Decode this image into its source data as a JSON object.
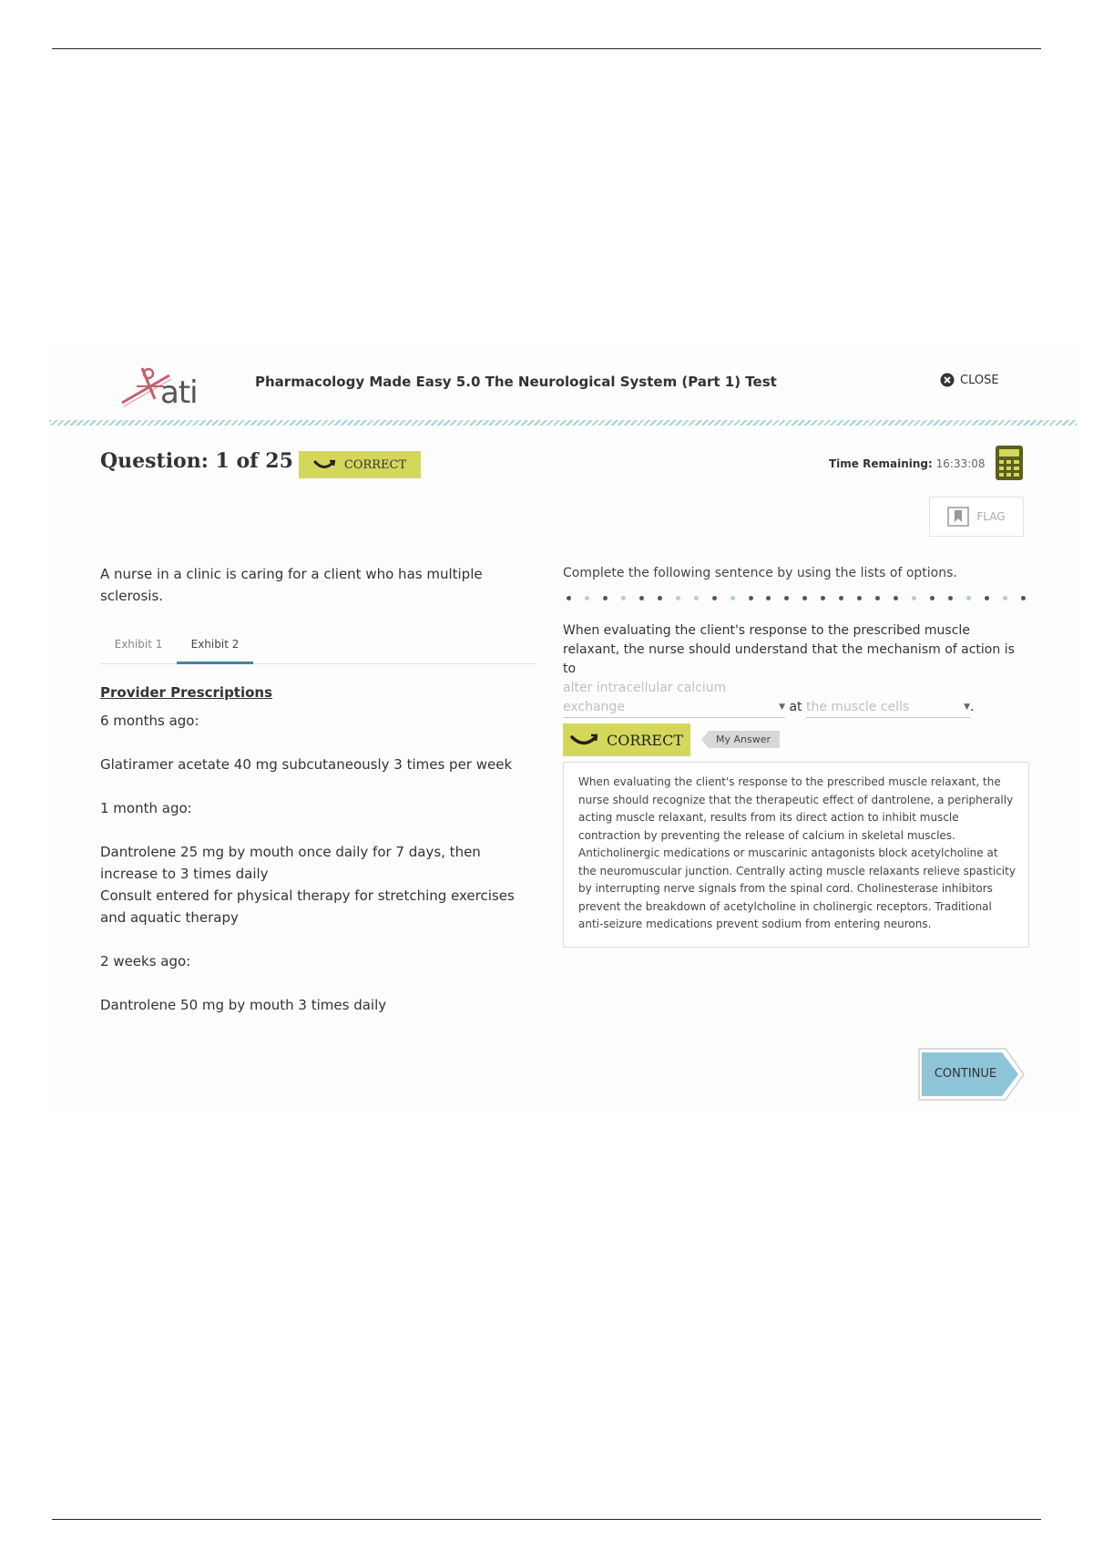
{
  "header": {
    "logo_text": "ati",
    "test_title": "Pharmacology Made Easy 5.0 The Neurological System (Part 1) Test",
    "close_label": "CLOSE"
  },
  "question_bar": {
    "question_label": "Question: 1 of 25",
    "status_label": "CORRECT",
    "time_label": "Time Remaining:",
    "time_value": "16:33:08",
    "flag_label": "FLAG"
  },
  "left_pane": {
    "stem": "A nurse in a clinic is caring for a client who has multiple sclerosis.",
    "tabs": [
      {
        "label": "Exhibit 1",
        "active": false
      },
      {
        "label": "Exhibit 2",
        "active": true
      }
    ],
    "exhibit_heading": "Provider Prescriptions",
    "prescriptions": {
      "t1": "6 months ago:",
      "t1_rx1": "Glatiramer acetate 40 mg subcutaneously 3 times per week",
      "t2": "1 month ago:",
      "t2_rx1": "Dantrolene 25 mg by mouth once daily for 7 days, then increase to 3 times daily",
      "t2_rx2": "Consult entered for physical therapy for stretching exercises and aquatic therapy",
      "t3": "2 weeks ago:",
      "t3_rx1": "Dantrolene 50 mg by mouth 3 times daily"
    }
  },
  "right_pane": {
    "instruction": "Complete the following sentence by using the lists of options.",
    "sentence_part1": "When evaluating the client's response to the prescribed muscle relaxant, the nurse should understand that the mechanism of action is to",
    "dropdown_1": "alter intracellular calcium exchange",
    "sentence_part2": "at",
    "dropdown_2": "the muscle cells",
    "sentence_end": ".",
    "result_label": "CORRECT",
    "my_answer_label": "My Answer",
    "rationale": "When evaluating the client's response to the prescribed muscle relaxant, the nurse should recognize that the therapeutic effect of dantrolene, a peripherally acting muscle relaxant, results from its direct action to inhibit muscle contraction by preventing the release of calcium in skeletal muscles. Anticholinergic medications or muscarinic antagonists block acetylcholine at the neuromuscular junction. Centrally acting muscle relaxants relieve spasticity by interrupting nerve signals from the spinal cord. Cholinesterase inhibitors prevent the breakdown of acetylcholine in cholinergic receptors. Traditional anti-seizure medications prevent sodium from entering neurons."
  },
  "footer": {
    "continue_label": "CONTINUE"
  },
  "colors": {
    "correct_badge": "#d4d85a",
    "accent_teal": "#a6d4d3",
    "continue_fill": "#8fc5d9",
    "tab_active": "#3d86a6",
    "calculator": "#5a5f1e"
  },
  "icons": {
    "close": "close-circle-icon",
    "calculator": "calculator-icon",
    "flag": "bookmark-flag-icon",
    "correct": "checkmark-swoosh-icon",
    "continue": "arrow-right-icon"
  }
}
